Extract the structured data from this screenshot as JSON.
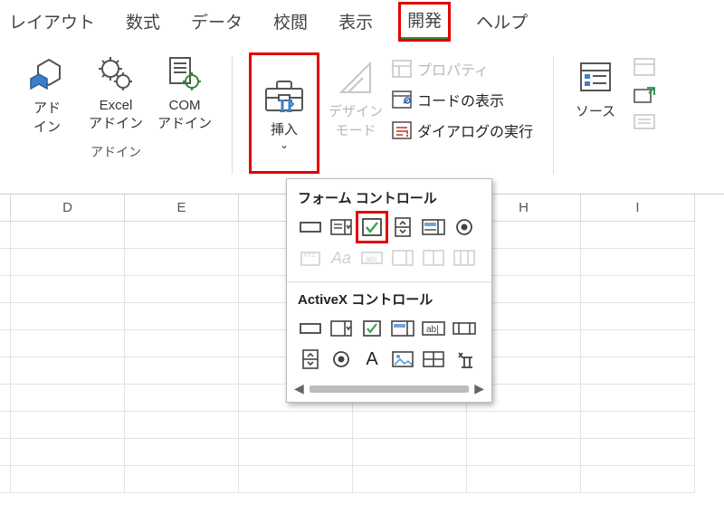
{
  "tabs": {
    "layout": "レイアウト",
    "formulas": "数式",
    "data": "データ",
    "review": "校閲",
    "view": "表示",
    "developer": "開発",
    "help": "ヘルプ"
  },
  "ribbon": {
    "addins": {
      "addins_label": "アド\nイン",
      "excel_addins_label": "Excel\nアドイン",
      "com_addins_label": "COM\nアドイン",
      "group_label": "アドイン"
    },
    "insert_label": "挿入",
    "design_mode_label": "デザイン\nモード",
    "properties": "プロパティ",
    "view_code": "コードの表示",
    "run_dialog": "ダイアログの実行",
    "source": "ソース"
  },
  "dropdown": {
    "form_title": "フォーム コントロール",
    "activex_title": "ActiveX コントロール"
  },
  "columns": [
    "D",
    "E",
    "",
    "",
    "",
    "H",
    "I"
  ]
}
